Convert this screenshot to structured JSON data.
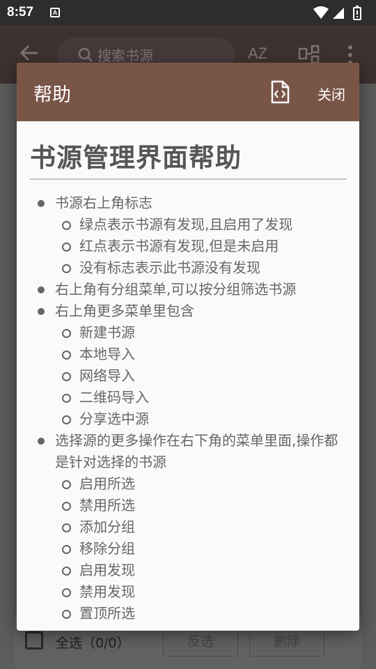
{
  "status_bar": {
    "time": "8:57",
    "notification_letter": "A"
  },
  "app_bar": {
    "search_placeholder": "搜索书源",
    "sort_label": "AZ"
  },
  "dialog": {
    "title": "帮助",
    "close_label": "关闭",
    "heading": "书源管理界面帮助",
    "items": [
      {
        "level": 1,
        "text": "书源右上角标志"
      },
      {
        "level": 2,
        "text": "绿点表示书源有发现,且启用了发现"
      },
      {
        "level": 2,
        "text": "红点表示书源有发现,但是未启用"
      },
      {
        "level": 2,
        "text": "没有标志表示此书源没有发现"
      },
      {
        "level": 1,
        "text": "右上角有分组菜单,可以按分组筛选书源"
      },
      {
        "level": 1,
        "text": "右上角更多菜单里包含"
      },
      {
        "level": 2,
        "text": "新建书源"
      },
      {
        "level": 2,
        "text": "本地导入"
      },
      {
        "level": 2,
        "text": "网络导入"
      },
      {
        "level": 2,
        "text": "二维码导入"
      },
      {
        "level": 2,
        "text": "分享选中源"
      },
      {
        "level": 1,
        "text": "选择源的更多操作在右下角的菜单里面,操作都是针对选择的书源"
      },
      {
        "level": 2,
        "text": "启用所选"
      },
      {
        "level": 2,
        "text": "禁用所选"
      },
      {
        "level": 2,
        "text": "添加分组"
      },
      {
        "level": 2,
        "text": "移除分组"
      },
      {
        "level": 2,
        "text": "启用发现"
      },
      {
        "level": 2,
        "text": "禁用发现"
      },
      {
        "level": 2,
        "text": "置顶所选"
      }
    ]
  },
  "bottom_bar": {
    "select_all": "全选（0/0）",
    "invert": "反选",
    "delete": "删除"
  },
  "colors": {
    "dialog_header": "#795548",
    "status_bar": "#2e2d2c",
    "text": "#666666"
  }
}
